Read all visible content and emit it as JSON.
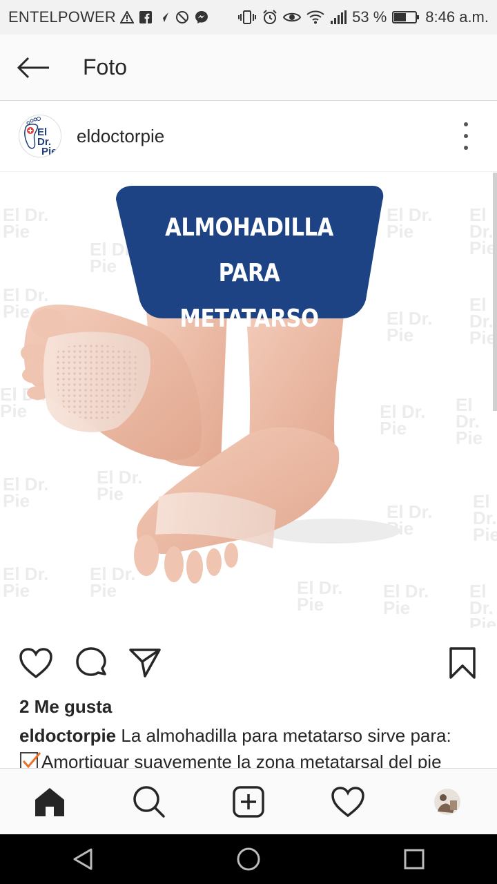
{
  "status_bar": {
    "carrier": "ENTELPOWER",
    "battery": "53 %",
    "time": "8:46 a.m."
  },
  "header": {
    "title": "Foto"
  },
  "post": {
    "avatar_text_line1": "El Dr.",
    "avatar_text_line2": "Pie",
    "username": "eldoctorpie",
    "image": {
      "banner_line1": "ALMOHADILLA PARA",
      "banner_line2": "METATARSO",
      "watermark_line1": "El Dr.",
      "watermark_line2": "Pie"
    },
    "likes": "2 Me gusta",
    "caption_user": "eldoctorpie",
    "caption_text": "La almohadilla para metatarso sirve para:",
    "caption_line2": "Amortiguar suavemente la zona metatarsal del pie"
  },
  "colors": {
    "banner_blue": "#1d4384",
    "check_orange": "#e8702a"
  },
  "icons": {
    "like": "heart-icon",
    "comment": "comment-icon",
    "share": "send-icon",
    "save": "bookmark-icon"
  }
}
